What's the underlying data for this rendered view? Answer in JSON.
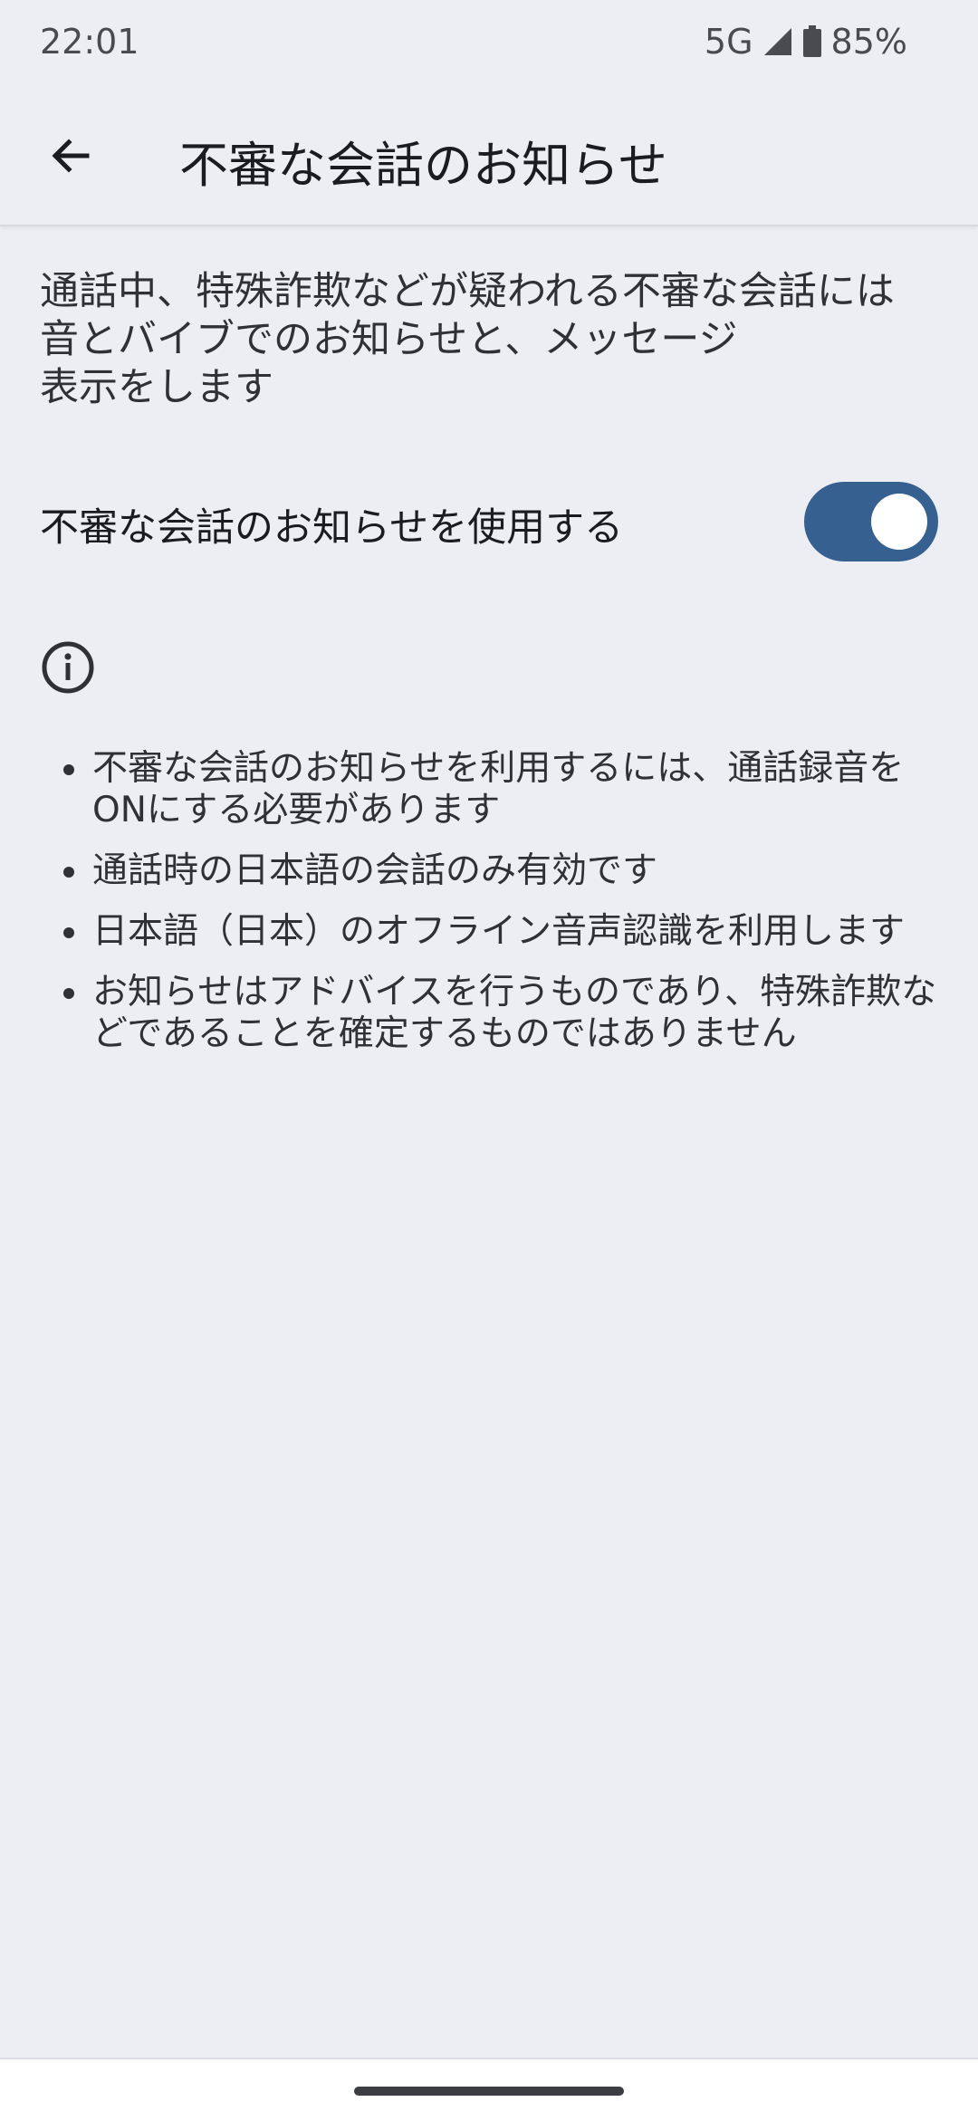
{
  "status_bar": {
    "time": "22:01",
    "network": "5G",
    "battery": "85%"
  },
  "app_bar": {
    "title": "不審な会話のお知らせ"
  },
  "description": "通話中、特殊詐欺などが疑われる不審な会話には\n音とバイブでのお知らせと、メッセージ\n表示をします",
  "toggle": {
    "label": "不審な会話のお知らせを使用する",
    "state": "on",
    "color": "#36608f"
  },
  "notes": [
    "不審な会話のお知らせを利用するには、通話録音をONにする必要があります",
    "通話時の日本語の会話のみ有効です",
    "日本語（日本）のオフライン音声認識を利用します",
    "お知らせはアドバイスを行うものであり、特殊詐欺などであることを確定するものではありません"
  ],
  "icons": {
    "back": "arrow-back-icon",
    "info": "info-icon",
    "signal": "signal-icon",
    "battery": "battery-icon"
  },
  "colors": {
    "background": "#edeef3",
    "accent": "#36608f"
  }
}
